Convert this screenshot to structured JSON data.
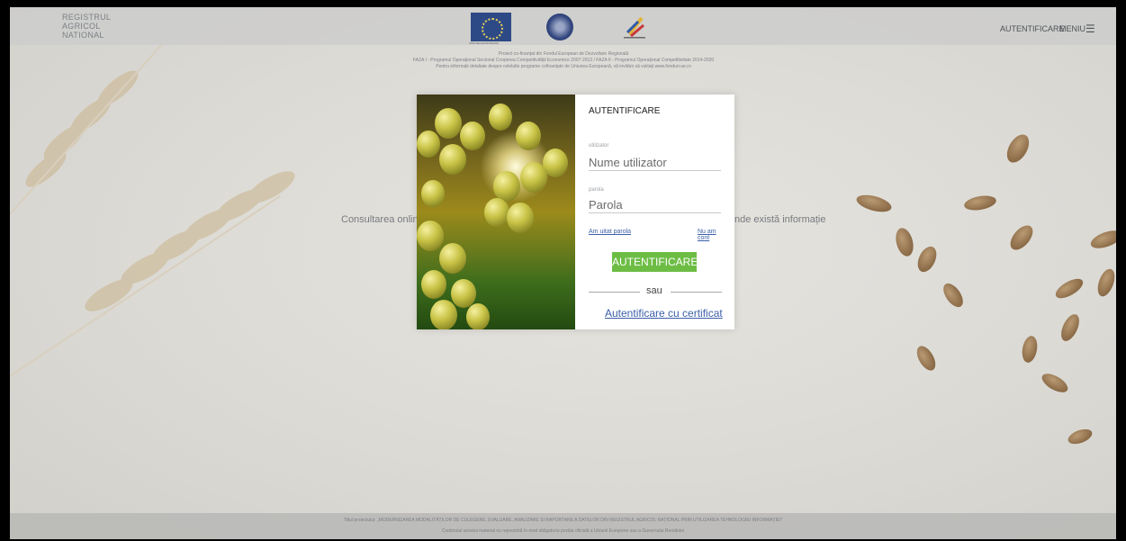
{
  "header": {
    "logo_lines": [
      "REGISTRUL",
      "AGRICOL",
      "NATIONAL"
    ],
    "eu_flag_caption": "UNIUNEA EUROPEANĂ",
    "nav": {
      "auth": "AUTENTIFICARE",
      "menu": "MENIU",
      "menu_icon": "☰"
    }
  },
  "subheader": {
    "line1": "Proiect co-finanțat din Fondul European de Dezvoltare Regională",
    "line2": "FAZA I - Programul Operațional Sectorial Creșterea Competitivității Economice 2007-2013 / FAZA II - Programul Operațional Competitivitate 2014-2020",
    "line3": "Pentru informații detaliate despre celelalte programe cofinanțate de Uniunea Europeană, vă invităm să vizitați www.fonduri-ue.ro"
  },
  "tagline": {
    "left": "Consultarea online a",
    "right": "nde există informație"
  },
  "modal": {
    "title": "AUTENTIFICARE",
    "user_label": "utilizator",
    "user_placeholder": "Nume utilizator",
    "pass_label": "parola",
    "pass_placeholder": "Parola",
    "forgot_link": "Am uitat parola",
    "no_account_link": "Nu am cont",
    "submit_label": "AUTENTIFICARE",
    "or_text": "sau",
    "cert_link": "Autentificare cu certificat"
  },
  "footer": {
    "line1": "Titlul proiectului: „MODERNIZAREA MODALITĂȚILOR DE CULEGERE, EVALUARE, ANALIZARE ȘI RAPORTARE A DATELOR DIN REGISTRUL AGRICOL NAȚIONAL PRIN UTILIZAREA TEHNOLOGIEI INFORMAȚIEI”",
    "line2": "Conținutul acestui material nu reprezintă în mod obligatoriu poziția oficială a Uniunii Europene sau a Guvernului României"
  }
}
